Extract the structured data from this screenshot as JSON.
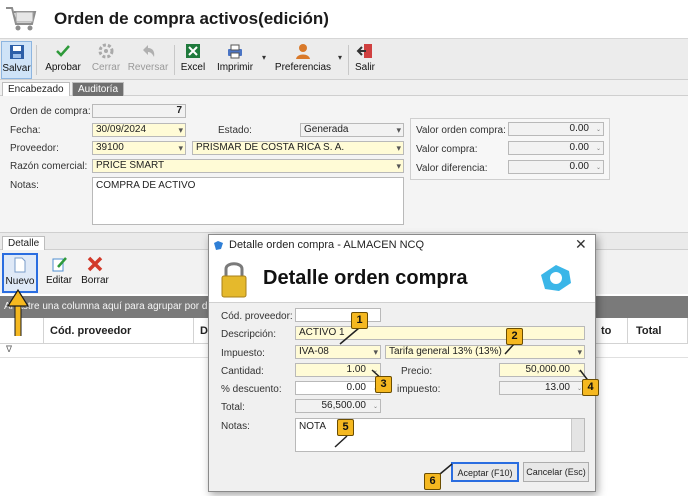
{
  "window": {
    "title": "Orden de compra activos(edición)"
  },
  "toolbar": {
    "items": [
      {
        "label": "Salvar",
        "icon": "save-icon"
      },
      {
        "label": "Aprobar",
        "icon": "check-icon"
      },
      {
        "label": "Cerrar",
        "icon": "gear-icon"
      },
      {
        "label": "Reversar",
        "icon": "undo-icon"
      },
      {
        "label": "Excel",
        "icon": "excel-icon"
      },
      {
        "label": "Imprimir",
        "icon": "printer-icon"
      },
      {
        "label": "Preferencias",
        "icon": "user-icon"
      },
      {
        "label": "Salir",
        "icon": "exit-icon"
      }
    ]
  },
  "tabs": {
    "encabezado": "Encabezado",
    "auditoria": "Auditoría"
  },
  "header": {
    "orden_label": "Orden de compra:",
    "orden_value": "7",
    "fecha_label": "Fecha:",
    "fecha_value": "30/09/2024",
    "estado_label": "Estado:",
    "estado_value": "Generada",
    "proveedor_label": "Proveedor:",
    "proveedor_code": "39100",
    "proveedor_name": "PRISMAR DE COSTA RICA S. A.",
    "razon_label": "Razón comercial:",
    "razon_value": "PRICE SMART",
    "notas_label": "Notas:",
    "notas_value": "COMPRA DE ACTIVO",
    "valor_orden_label": "Valor orden compra:",
    "valor_orden_value": "0.00",
    "valor_compra_label": "Valor compra:",
    "valor_compra_value": "0.00",
    "valor_dif_label": "Valor diferencia:",
    "valor_dif_value": "0.00"
  },
  "detalle": {
    "tab": "Detalle",
    "nuevo": "Nuevo",
    "editar": "Editar",
    "borrar": "Borrar",
    "group_hint": "Arrastre una columna aquí para agrupar por dich",
    "col_cod": "Cód. proveedor",
    "col_d": "D",
    "col_to": "to",
    "col_total": "Total"
  },
  "dialog": {
    "title": "Detalle orden compra - ALMACEN NCQ",
    "heading": "Detalle orden compra",
    "cod_label": "Cód. proveedor:",
    "cod_value": "",
    "desc_label": "Descripción:",
    "desc_value": "ACTIVO 1",
    "imp_label": "Impuesto:",
    "imp_value": "IVA-08",
    "tarifa_value": "Tarifa general 13% (13%)",
    "cant_label": "Cantidad:",
    "cant_value": "1.00",
    "precio_label": "Precio:",
    "precio_value": "50,000.00",
    "desc_pct_label": "% descuento:",
    "desc_pct_value": "0.00",
    "impuesto_label": "impuesto:",
    "impuesto_value": "13.00",
    "total_label": "Total:",
    "total_value": "56,500.00",
    "notas_label": "Notas:",
    "notas_value": "NOTA",
    "aceptar": "Aceptar (F10)",
    "cancelar": "Cancelar (Esc)"
  },
  "callouts": [
    "1",
    "2",
    "3",
    "4",
    "5",
    "6"
  ],
  "colors": {
    "accent": "#2a6de0",
    "callout": "#f5b820",
    "field_yellow": "#fffbd6"
  }
}
